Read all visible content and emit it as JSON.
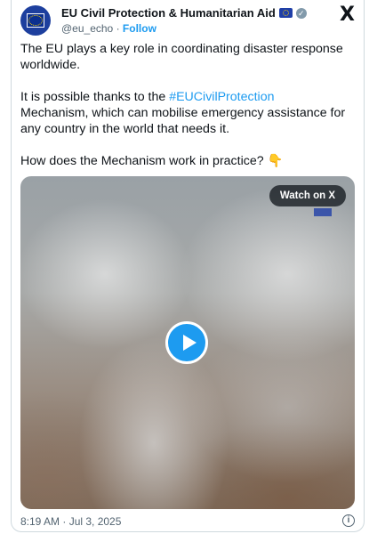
{
  "header": {
    "name": "EU Civil Protection & Humanitarian Aid",
    "handle": "@eu_echo",
    "separator": "·",
    "follow_label": "Follow",
    "x_logo": "X"
  },
  "tweet": {
    "line1": "The EU plays a key role in coordinating disaster response worldwide.",
    "line2_prefix": "It is possible thanks to the ",
    "hashtag": "#EUCivilProtection",
    "line2_suffix": "Mechanism, which can mobilise emergency assistance for any country in the world that needs it.",
    "line3": "How does the Mechanism work in practice? 👇"
  },
  "media": {
    "watch_label": "Watch on X"
  },
  "footer": {
    "timestamp": "8:19 AM · Jul 3, 2025",
    "info_icon": "i"
  },
  "colors": {
    "link": "#1d9bf0",
    "secondary_text": "#536471",
    "verified": "#829aab",
    "eu_blue": "#1f3fa8"
  },
  "icons": [
    "eu-flag-icon",
    "verified-badge-icon",
    "x-logo-icon",
    "play-icon",
    "info-icon"
  ]
}
